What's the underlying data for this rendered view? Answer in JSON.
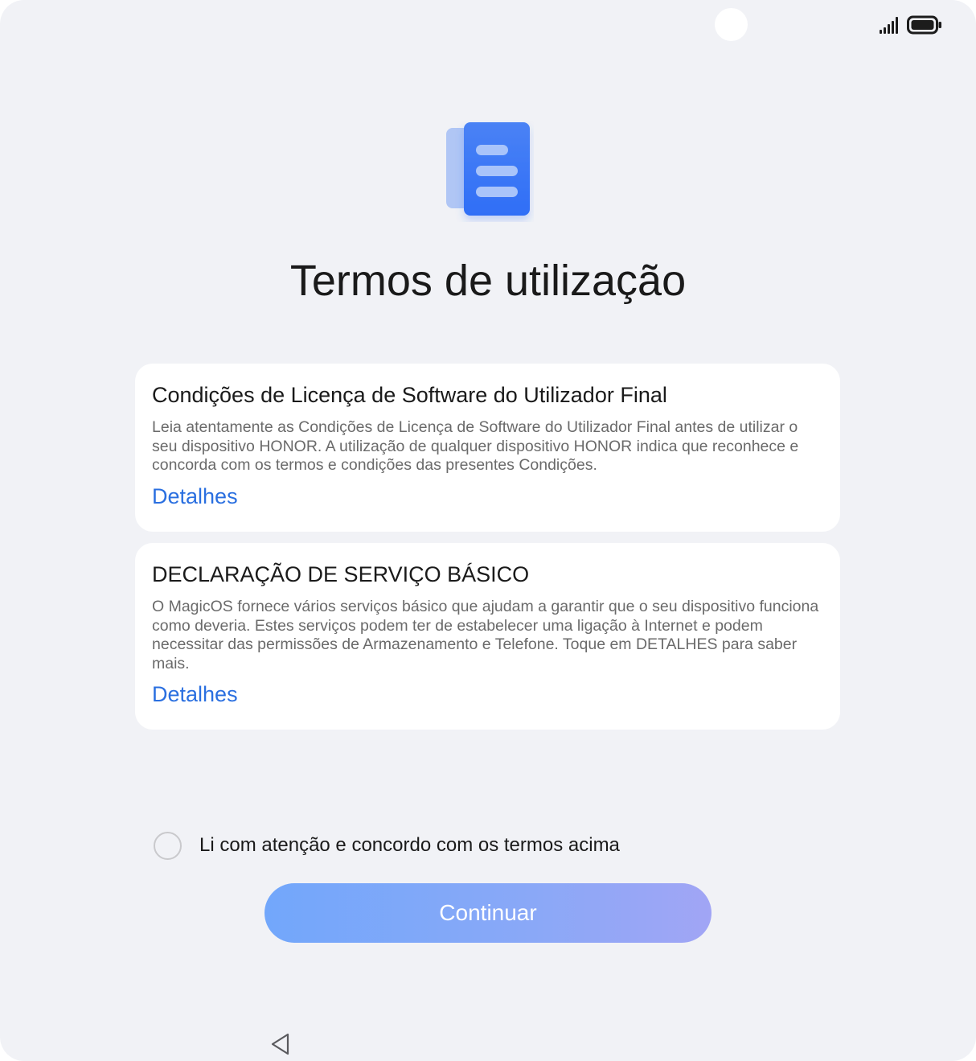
{
  "status_bar": {
    "icons": [
      "camera-dot",
      "signal-icon",
      "battery-icon"
    ]
  },
  "hero": {
    "icon": "document-icon",
    "title": "Termos de utilização"
  },
  "cards": [
    {
      "title": "Condições de Licença de Software do Utilizador Final",
      "body": "Leia atentamente as Condições de Licença de Software do Utilizador Final antes de utilizar o seu dispositivo HONOR. A utilização de qualquer dispositivo HONOR indica que reconhece e concorda com os termos e condições das presentes Condições.",
      "link": "Detalhes"
    },
    {
      "title": "DECLARAÇÃO DE SERVIÇO BÁSICO",
      "body": "O MagicOS fornece vários serviços básico que ajudam a garantir que o seu dispositivo funciona como deveria. Estes serviços podem ter de estabelecer uma ligação à Internet e podem necessitar das permissões de Armazenamento e Telefone. Toque em DETALHES para saber mais.",
      "link": "Detalhes"
    }
  ],
  "agreement": {
    "label": "Li com atenção e concordo com os termos acima",
    "checked": false
  },
  "continue_button": {
    "label": "Continuar",
    "enabled": false
  },
  "nav_bar": {
    "icon": "back-triangle-icon"
  },
  "colors": {
    "background": "#f1f2f6",
    "card": "#ffffff",
    "link": "#2a6fe0",
    "accent": "#3d78f5",
    "button_gradient_start": "#72a7fb",
    "button_gradient_end": "#a1a5f5"
  }
}
